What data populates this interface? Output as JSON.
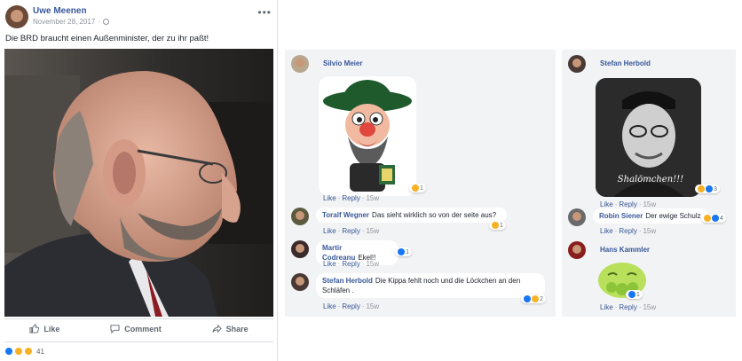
{
  "post": {
    "author": "Uwe Meenen",
    "date": "November 28, 2017",
    "more": "•••",
    "text": "Die BRD braucht einen Außenminister, der zu ihr paßt!",
    "actions": {
      "like": "Like",
      "comment": "Comment",
      "share": "Share"
    },
    "reactions_count": "41"
  },
  "comments_left": [
    {
      "name": "Silvio Meier",
      "text": "",
      "like": "Like",
      "reply": "Reply",
      "time": "15w",
      "reactions": "1",
      "sticker": "caricature-sticker"
    },
    {
      "name": "Toralf Wegner",
      "text": "Das sieht wirklich so von der seite aus?",
      "like": "Like",
      "reply": "Reply",
      "time": "15w",
      "reactions": "1"
    },
    {
      "name": "Martir Codreanu",
      "text": "Ekel!!",
      "like": "Like",
      "reply": "Reply",
      "time": "15w",
      "reactions": "1"
    },
    {
      "name": "Stefan Herbold",
      "text": "Die Kippa fehlt noch und die Löckchen an den Schläfen .",
      "like": "Like",
      "reply": "Reply",
      "time": "15w",
      "reactions": "2"
    }
  ],
  "comments_right": [
    {
      "name": "Stefan Herbold",
      "text": "",
      "like": "Like",
      "reply": "Reply",
      "time": "15w",
      "reactions": "3",
      "image_caption": "Shalömchen!!!"
    },
    {
      "name": "Robin Siener",
      "text": "Der ewige Schulz",
      "like": "Like",
      "reply": "Reply",
      "time": "15w",
      "reactions": "4"
    },
    {
      "name": "Hans Kammler",
      "text": "",
      "like": "Like",
      "reply": "Reply",
      "time": "15w",
      "reactions": "1",
      "sticker": "sick-face-sticker"
    }
  ],
  "colors": {
    "link": "#385898",
    "panel_bg": "#f2f3f5",
    "meta": "#90949c",
    "like_blue": "#1877f2",
    "haha_yellow": "#f7b125"
  }
}
